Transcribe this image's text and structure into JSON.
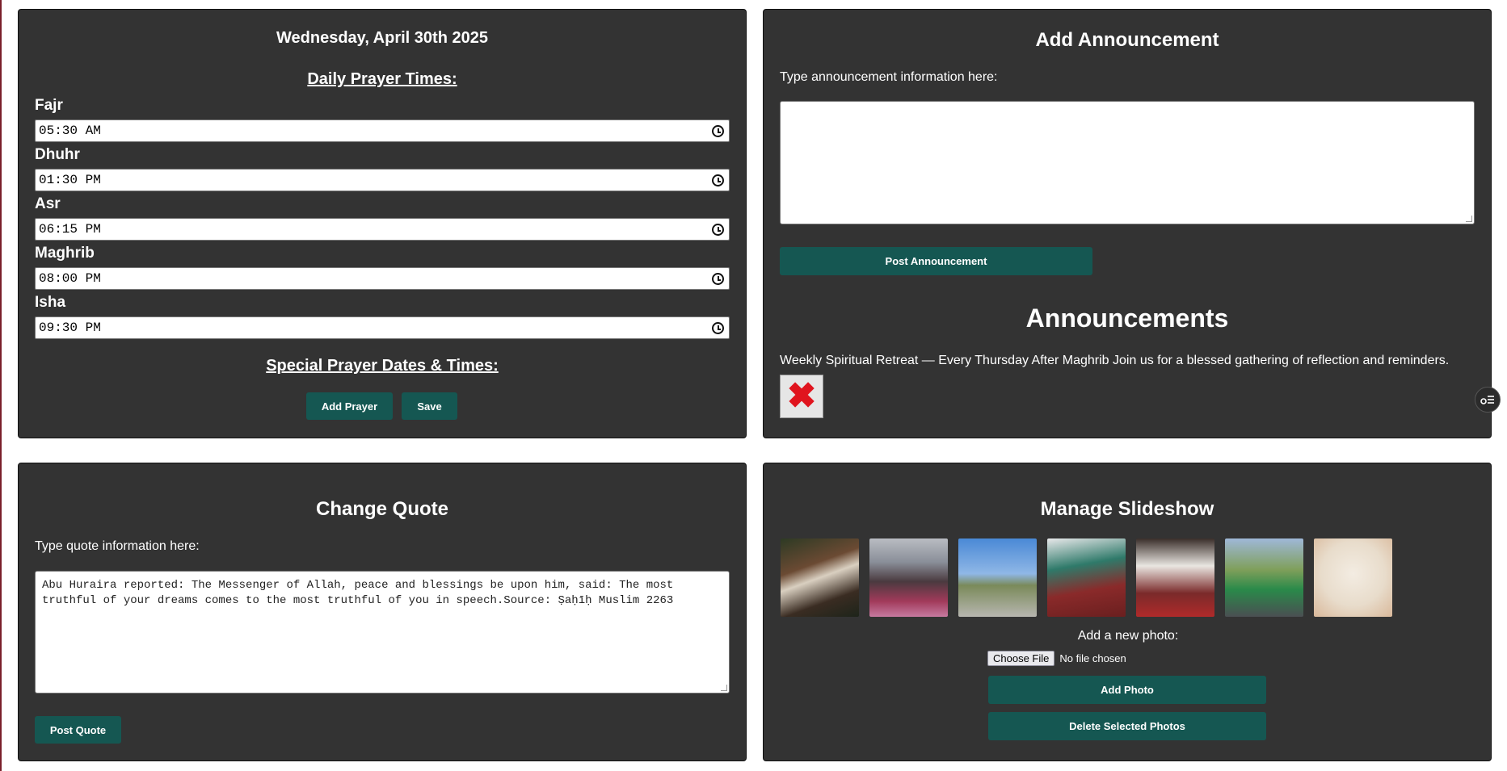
{
  "prayer_panel": {
    "date": "Wednesday, April 30th 2025",
    "daily_title": "Daily Prayer Times:",
    "prayers": [
      {
        "name": "Fajr",
        "time": "05:30 AM"
      },
      {
        "name": "Dhuhr",
        "time": "01:30 PM"
      },
      {
        "name": "Asr",
        "time": "06:15 PM"
      },
      {
        "name": "Maghrib",
        "time": "08:00 PM"
      },
      {
        "name": "Isha",
        "time": "09:30 PM"
      }
    ],
    "special_title": "Special Prayer Dates & Times:",
    "add_prayer_label": "Add Prayer",
    "save_label": "Save"
  },
  "announce_panel": {
    "title": "Add Announcement",
    "helper": "Type announcement information here:",
    "textarea_value": "",
    "post_label": "Post Announcement",
    "list_title": "Announcements",
    "items": [
      {
        "text": "Weekly Spiritual Retreat — Every Thursday After Maghrib Join us for a blessed gathering of reflection and reminders."
      }
    ]
  },
  "quote_panel": {
    "title": "Change Quote",
    "helper": "Type quote information here:",
    "textarea_value": "Abu Huraira reported: The Messenger of Allah, peace and blessings be upon him, said: The most truthful of your dreams comes to the most truthful of you in speech.Source: Ṣaḥīḥ Muslim 2263",
    "post_label": "Post Quote"
  },
  "slideshow_panel": {
    "title": "Manage Slideshow",
    "add_photo_caption": "Add a new photo:",
    "choose_file_label": "Choose File",
    "no_file_text": "No file chosen",
    "add_photo_label": "Add Photo",
    "delete_label": "Delete Selected Photos",
    "thumbnails": [
      "photo-1",
      "photo-2",
      "photo-3",
      "photo-4",
      "photo-5",
      "photo-6",
      "photo-7"
    ]
  },
  "colors": {
    "panel_bg": "#333333",
    "button_bg": "#155752",
    "page_bg": "#ffffff"
  }
}
